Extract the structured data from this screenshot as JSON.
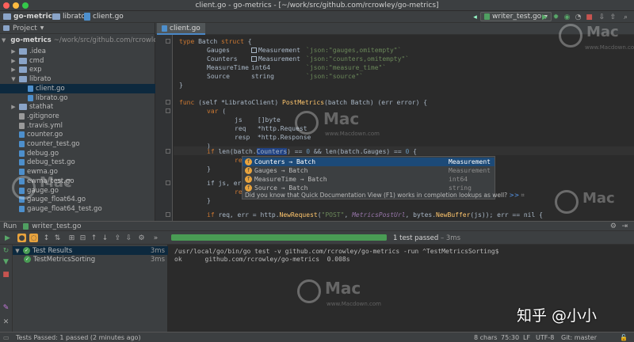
{
  "window": {
    "title": "client.go - go-metrics - [~/work/src/github.com/rcrowley/go-metrics]",
    "traffic_colors": [
      "#fc605b",
      "#fdbc40",
      "#34c84a"
    ]
  },
  "navbar": {
    "crumbs": [
      "go-metrics",
      "librato",
      "client.go"
    ],
    "run_config": "writer_test.go"
  },
  "project": {
    "header": "Project",
    "root_name": "go-metrics",
    "root_path": "~/work/src/github.com/rcrowley",
    "items": [
      {
        "label": ".idea",
        "kind": "folder",
        "indent": 1,
        "expanded": false
      },
      {
        "label": "cmd",
        "kind": "folder",
        "indent": 1,
        "expanded": false
      },
      {
        "label": "exp",
        "kind": "folder",
        "indent": 1,
        "expanded": false
      },
      {
        "label": "librato",
        "kind": "folder",
        "indent": 1,
        "expanded": true
      },
      {
        "label": "client.go",
        "kind": "file",
        "indent": 2,
        "selected": true
      },
      {
        "label": "librato.go",
        "kind": "file",
        "indent": 2
      },
      {
        "label": "stathat",
        "kind": "folder",
        "indent": 1,
        "expanded": false
      },
      {
        "label": ".gitignore",
        "kind": "file",
        "indent": 1
      },
      {
        "label": ".travis.yml",
        "kind": "file",
        "indent": 1
      },
      {
        "label": "counter.go",
        "kind": "file",
        "indent": 1
      },
      {
        "label": "counter_test.go",
        "kind": "file",
        "indent": 1
      },
      {
        "label": "debug.go",
        "kind": "file",
        "indent": 1
      },
      {
        "label": "debug_test.go",
        "kind": "file",
        "indent": 1
      },
      {
        "label": "ewma.go",
        "kind": "file",
        "indent": 1
      },
      {
        "label": "ewma_test.go",
        "kind": "file",
        "indent": 1
      },
      {
        "label": "gauge.go",
        "kind": "file",
        "indent": 1
      },
      {
        "label": "gauge_float64.go",
        "kind": "file",
        "indent": 1
      },
      {
        "label": "gauge_float64_test.go",
        "kind": "file",
        "indent": 1
      }
    ]
  },
  "editor": {
    "tab": "client.go",
    "code": {
      "l1_kw": "type",
      "l1_name": " Batch ",
      "l1_kw2": "struct",
      "l1_end": " {",
      "f1_name": "Gauges",
      "f1_type": "Measurement",
      "f1_tag": "`json:\"gauges,omitempty\"`",
      "f2_name": "Counters",
      "f2_type": "Measurement",
      "f2_tag": "`json:\"counters,omitempty\"`",
      "f3_name": "MeasureTime",
      "f3_type": "int64",
      "f3_tag": "`json:\"measure_time\"`",
      "f4_name": "Source",
      "f4_type": "string",
      "f4_tag": "`json:\"source\"`",
      "close": "}",
      "fn_kw": "func",
      "fn_recv": " (self *LibratoClient) ",
      "fn_name": "PostMetrics",
      "fn_params": "(batch Batch) (err error) {",
      "var_kw": "var",
      "var_open": " (",
      "v1": "js    []byte",
      "v2": "req   *http.Request",
      "v3": "resp  *http.Response",
      "var_close": ")",
      "if1_kw": "if",
      "if1_a": " len(batch.",
      "if1_ident": "Counters",
      "if1_b": ") == ",
      "if1_n1": "0",
      "if1_c": " && len(batch.Gauges) == ",
      "if1_n2": "0",
      "if1_d": " {",
      "ret": "re",
      "brace": "}",
      "if2": "if js, err",
      "ret2": "re",
      "if3_kw": "if",
      "if3_a": " req, err = http.",
      "if3_fn": "NewRequest",
      "if3_b": "(",
      "if3_str": "\"POST\"",
      "if3_c": ", ",
      "if3_it": "MetricsPostUrl",
      "if3_d": ", bytes.",
      "if3_fn2": "NewBuffer",
      "if3_e": "(js)); err == nil {"
    }
  },
  "completion": {
    "items": [
      {
        "name": "Counters → Batch",
        "type": "Measurement",
        "active": true
      },
      {
        "name": "Gauges → Batch",
        "type": "Measurement"
      },
      {
        "name": "MeasureTime → Batch",
        "type": "int64"
      },
      {
        "name": "Source → Batch",
        "type": "string"
      }
    ],
    "hint": "Did you know that Quick Documentation View (F1) works in completion lookups as well?",
    "hint_link": ">>"
  },
  "run": {
    "header_label": "Run",
    "config_tab": "writer_test.go",
    "progress": 1.0,
    "passed_text": "1 test passed",
    "passed_time": "– 3ms",
    "tree": [
      {
        "label": "Test Results",
        "time": "3ms",
        "indent": 1,
        "selected": true
      },
      {
        "label": "TestMetricsSorting",
        "time": "3ms",
        "indent": 2
      }
    ],
    "console": [
      "/usr/local/go/bin/go test -v github.com/rcrowley/go-metrics -run ^TestMetricsSorting$",
      "ok      github.com/rcrowley/go-metrics  0.008s"
    ]
  },
  "status": {
    "message": "Tests Passed: 1 passed (2 minutes ago)",
    "chars": "8 chars",
    "position": "75:30",
    "line_sep": "LF",
    "encoding": "UTF-8",
    "vcs": "Git: master"
  },
  "watermarks": {
    "brand": "Mac",
    "site": "www.Macdown.com",
    "zh": "知乎 @小小"
  }
}
